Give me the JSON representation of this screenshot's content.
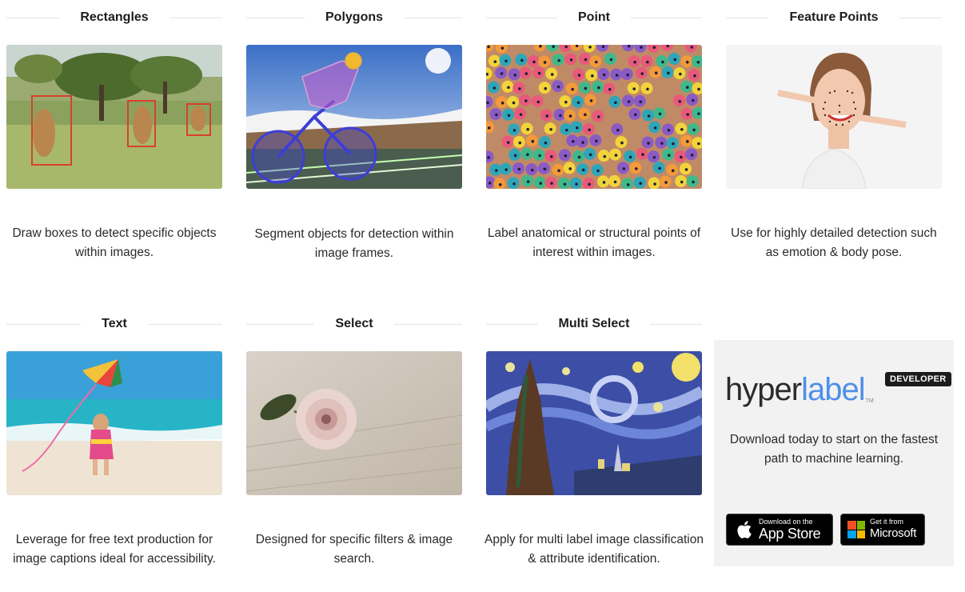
{
  "cards": [
    {
      "title": "Rectangles",
      "description": "Draw boxes to detect specific objects within images."
    },
    {
      "title": "Polygons",
      "description": "Segment objects for detection within image frames."
    },
    {
      "title": "Point",
      "description": "Label anatomical or structural points of interest within images."
    },
    {
      "title": "Feature Points",
      "description": "Use for highly detailed detection such as emotion & body pose."
    },
    {
      "title": "Text",
      "description": "Leverage for free text production for image captions ideal for accessibility."
    },
    {
      "title": "Select",
      "description": "Designed for specific filters & image search."
    },
    {
      "title": "Multi Select",
      "description": "Apply for multi label image classification & attribute identification."
    }
  ],
  "promo": {
    "logo_dark": "hyper",
    "logo_light": "label",
    "logo_tm": "TM",
    "badge": "DEVELOPER",
    "text": "Download today to start on the fastest path to machine learning.",
    "app_store": {
      "small": "Download on the",
      "big": "App Store"
    },
    "microsoft": {
      "small": "Get it from",
      "big": "Microsoft"
    }
  },
  "colors": {
    "brand_blue": "#4f8fe8",
    "promo_bg": "#f2f2f2",
    "annotation_red": "#d9402b"
  }
}
